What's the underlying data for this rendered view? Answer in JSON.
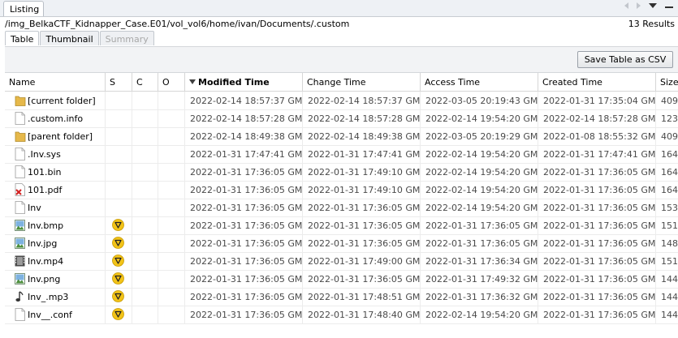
{
  "top_tab": "Listing",
  "path": "/img_BelkaCTF_Kidnapper_Case.E01/vol_vol6/home/ivan/Documents/.custom",
  "results": "13  Results",
  "subtabs": [
    "Table",
    "Thumbnail",
    "Summary"
  ],
  "save_csv_label": "Save Table as CSV",
  "columns": [
    "Name",
    "S",
    "C",
    "O",
    "Modified Time",
    "Change Time",
    "Access Time",
    "Created Time",
    "Size"
  ],
  "sorted_column": "Modified Time",
  "colors": {
    "tab_bg": "#eef1f5",
    "folder": "#e6b84a",
    "score_badge": "#f2c318",
    "pdf_x": "#d22020"
  },
  "rows": [
    {
      "icon": "folder-icon",
      "name": "[current folder]",
      "flag": false,
      "modified": "2022-02-14 18:57:37 GMT",
      "changed": "2022-02-14 18:57:37 GMT",
      "accessed": "2022-03-05 20:19:43 GMT",
      "created": "2022-01-31 17:35:04 GMT",
      "size": "409("
    },
    {
      "icon": "file-icon",
      "name": ".custom.info",
      "flag": false,
      "modified": "2022-02-14 18:57:28 GMT",
      "changed": "2022-02-14 18:57:28 GMT",
      "accessed": "2022-02-14 19:54:20 GMT",
      "created": "2022-02-14 18:57:28 GMT",
      "size": "123"
    },
    {
      "icon": "folder-icon",
      "name": "[parent folder]",
      "flag": false,
      "modified": "2022-02-14 18:49:38 GMT",
      "changed": "2022-02-14 18:49:38 GMT",
      "accessed": "2022-03-05 20:19:29 GMT",
      "created": "2022-01-08 18:55:32 GMT",
      "size": "409("
    },
    {
      "icon": "file-icon",
      "name": ".Inv.sys",
      "flag": false,
      "modified": "2022-01-31 17:47:41 GMT",
      "changed": "2022-01-31 17:47:41 GMT",
      "accessed": "2022-02-14 19:54:20 GMT",
      "created": "2022-01-31 17:47:41 GMT",
      "size": "164"
    },
    {
      "icon": "file-icon",
      "name": "101.bin",
      "flag": false,
      "modified": "2022-01-31 17:36:05 GMT",
      "changed": "2022-01-31 17:49:10 GMT",
      "accessed": "2022-02-14 19:54:20 GMT",
      "created": "2022-01-31 17:36:05 GMT",
      "size": "164"
    },
    {
      "icon": "pdf-icon",
      "name": "101.pdf",
      "flag": false,
      "modified": "2022-01-31 17:36:05 GMT",
      "changed": "2022-01-31 17:49:10 GMT",
      "accessed": "2022-02-14 19:54:20 GMT",
      "created": "2022-01-31 17:36:05 GMT",
      "size": "164"
    },
    {
      "icon": "file-icon",
      "name": "Inv",
      "flag": false,
      "modified": "2022-01-31 17:36:05 GMT",
      "changed": "2022-01-31 17:36:05 GMT",
      "accessed": "2022-02-14 19:54:20 GMT",
      "created": "2022-01-31 17:36:05 GMT",
      "size": "153"
    },
    {
      "icon": "image-icon",
      "name": "Inv.bmp",
      "flag": true,
      "modified": "2022-01-31 17:36:05 GMT",
      "changed": "2022-01-31 17:36:05 GMT",
      "accessed": "2022-01-31 17:36:05 GMT",
      "created": "2022-01-31 17:36:05 GMT",
      "size": "151("
    },
    {
      "icon": "image-icon",
      "name": "Inv.jpg",
      "flag": true,
      "modified": "2022-01-31 17:36:05 GMT",
      "changed": "2022-01-31 17:36:05 GMT",
      "accessed": "2022-01-31 17:36:05 GMT",
      "created": "2022-01-31 17:36:05 GMT",
      "size": "148"
    },
    {
      "icon": "video-icon",
      "name": "Inv.mp4",
      "flag": true,
      "modified": "2022-01-31 17:36:05 GMT",
      "changed": "2022-01-31 17:49:00 GMT",
      "accessed": "2022-01-31 17:36:34 GMT",
      "created": "2022-01-31 17:36:05 GMT",
      "size": "151"
    },
    {
      "icon": "image-icon",
      "name": "Inv.png",
      "flag": true,
      "modified": "2022-01-31 17:36:05 GMT",
      "changed": "2022-01-31 17:36:05 GMT",
      "accessed": "2022-01-31 17:49:32 GMT",
      "created": "2022-01-31 17:36:05 GMT",
      "size": "144"
    },
    {
      "icon": "audio-icon",
      "name": "Inv_.mp3",
      "flag": true,
      "modified": "2022-01-31 17:36:05 GMT",
      "changed": "2022-01-31 17:48:51 GMT",
      "accessed": "2022-01-31 17:36:32 GMT",
      "created": "2022-01-31 17:36:05 GMT",
      "size": "144"
    },
    {
      "icon": "file-icon",
      "name": "Inv__.conf",
      "flag": true,
      "modified": "2022-01-31 17:36:05 GMT",
      "changed": "2022-01-31 17:48:40 GMT",
      "accessed": "2022-02-14 19:54:20 GMT",
      "created": "2022-01-31 17:36:05 GMT",
      "size": "144("
    }
  ]
}
